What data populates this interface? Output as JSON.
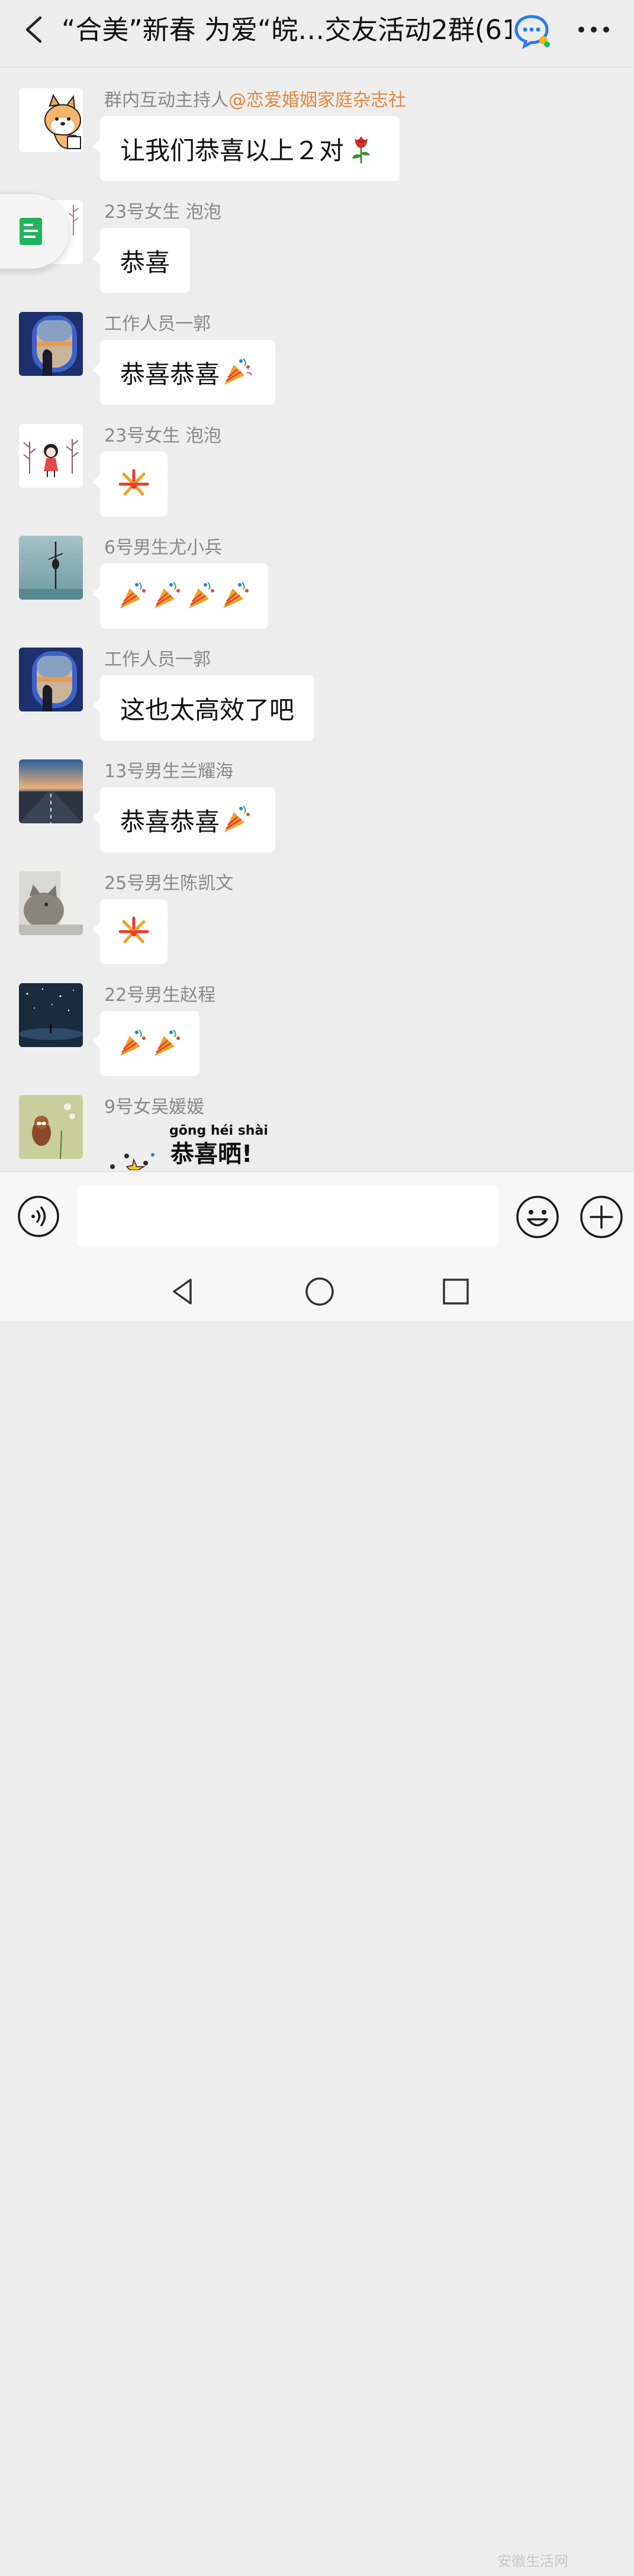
{
  "header": {
    "title": "“合美”新春 为爱“皖…交友活动2群(61)",
    "back_icon": "chevron-left-icon",
    "group_icon": "chat-bubble-icon",
    "more_icon": "more-dots-icon"
  },
  "messages": [
    {
      "sender": "群内互动主持人",
      "mention": "@恋爱婚姻家庭杂志社",
      "text": "让我们恭喜以上２对",
      "emoji": [
        "rose"
      ],
      "avatar": "shiba-dog"
    },
    {
      "sender": "23号女生 泡泡",
      "text": "恭喜",
      "avatar": "girl-drawing"
    },
    {
      "sender": "工作人员一郭",
      "text": "恭喜恭喜",
      "emoji": [
        "party-popper"
      ],
      "avatar": "airplane-window"
    },
    {
      "sender": "23号女生 泡泡",
      "text": "",
      "emoji": [
        "fireworks"
      ],
      "avatar": "girl-drawing"
    },
    {
      "sender": "6号男生尤小兵",
      "text": "",
      "emoji": [
        "party-popper",
        "party-popper",
        "party-popper",
        "party-popper"
      ],
      "avatar": "stilt-fisherman"
    },
    {
      "sender": "工作人员一郭",
      "text": "这也太高效了吧",
      "avatar": "airplane-window"
    },
    {
      "sender": "13号男生兰耀海",
      "text": "恭喜恭喜",
      "emoji": [
        "party-popper"
      ],
      "avatar": "road-sky"
    },
    {
      "sender": "25号男生陈凯文",
      "text": "",
      "emoji": [
        "fireworks"
      ],
      "avatar": "cat-window"
    },
    {
      "sender": "22号男生赵程",
      "text": "",
      "emoji": [
        "party-popper",
        "party-popper"
      ],
      "avatar": "starry-night"
    },
    {
      "sender": "9号女吴媛媛",
      "sticker": {
        "pinyin": "gōng héi shài",
        "text": "恭喜晒!"
      },
      "avatar": "red-panda"
    }
  ],
  "input": {
    "placeholder": "",
    "value": ""
  },
  "watermark": "安徽生活网",
  "colors": {
    "background": "#ededed",
    "bubble": "#ffffff",
    "mention": "#e08a43",
    "sender": "#8a8a8a"
  }
}
